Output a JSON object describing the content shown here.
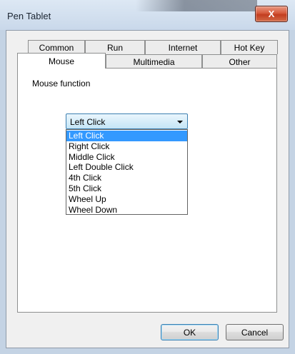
{
  "window": {
    "title": "Pen Tablet",
    "close_label": "X"
  },
  "tabs": {
    "row_back": [
      "Common",
      "Run",
      "Internet",
      "Hot Key"
    ],
    "row_front": [
      "Mouse",
      "Multimedia",
      "Other"
    ],
    "active": "Mouse"
  },
  "mouse_panel": {
    "label": "Mouse function",
    "combo_value": "Left Click",
    "options": [
      "Left Click",
      "Right Click",
      "Middle Click",
      "Left Double Click",
      "4th Click",
      "5th Click",
      "Wheel Up",
      "Wheel Down"
    ],
    "selected_index": 0
  },
  "buttons": {
    "ok": "OK",
    "cancel": "Cancel"
  },
  "colors": {
    "selection": "#3399ff",
    "close_button": "#c23d20"
  }
}
